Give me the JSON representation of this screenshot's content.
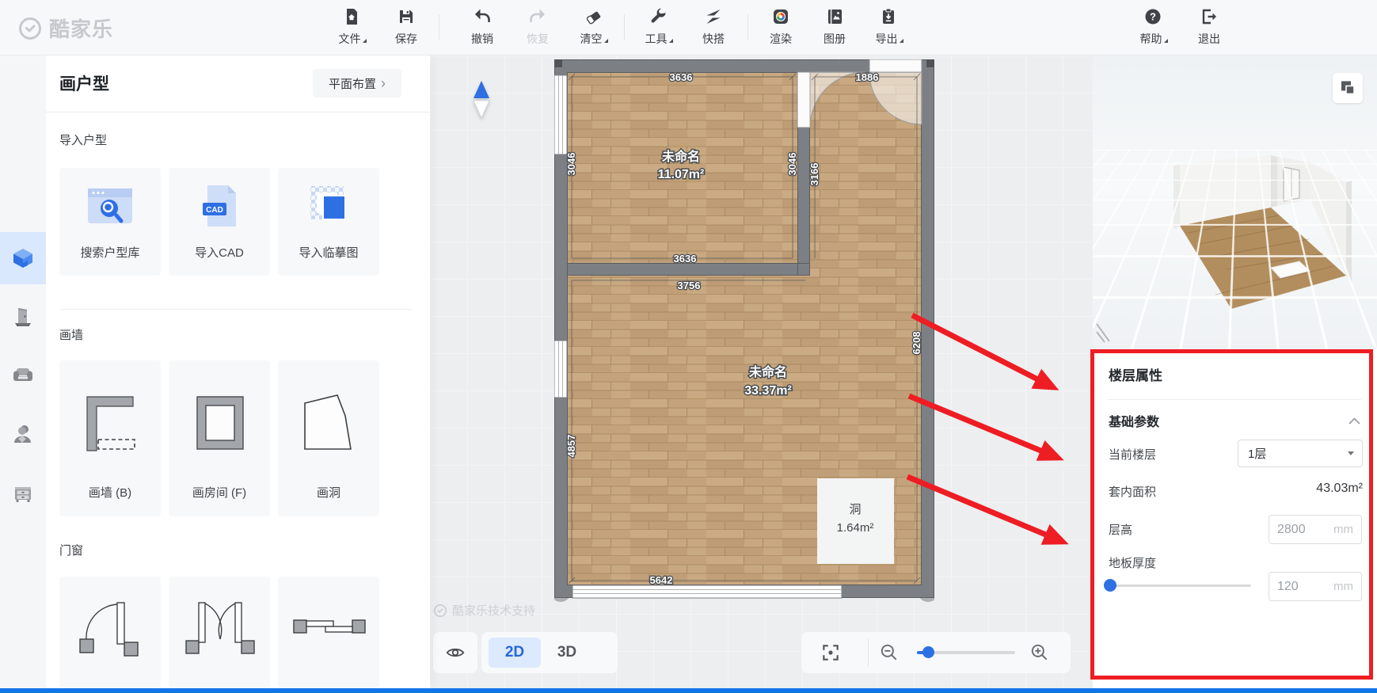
{
  "topbar": {
    "logo": "酷家乐",
    "items": [
      {
        "label": "文件"
      },
      {
        "label": "保存"
      },
      {
        "label": "撤销"
      },
      {
        "label": "恢复"
      },
      {
        "label": "清空"
      },
      {
        "label": "工具"
      },
      {
        "label": "快搭"
      },
      {
        "label": "渲染"
      },
      {
        "label": "图册"
      },
      {
        "label": "导出"
      },
      {
        "label": "帮助"
      },
      {
        "label": "退出"
      }
    ]
  },
  "left_panel": {
    "title": "画户型",
    "layout_switch": "平面布置",
    "section_import": {
      "title": "导入户型",
      "cards": [
        {
          "label": "搜索户型库"
        },
        {
          "label": "导入CAD",
          "badge": "CAD"
        },
        {
          "label": "导入临摹图"
        }
      ]
    },
    "section_wall": {
      "title": "画墙",
      "cards": [
        {
          "label": "画墙 (B)"
        },
        {
          "label": "画房间 (F)"
        },
        {
          "label": "画洞"
        }
      ]
    },
    "section_doors": {
      "title": "门窗"
    }
  },
  "canvas": {
    "watermark": "酷家乐技术支持",
    "rooms": [
      {
        "name": "未命名",
        "area": "11.07m²"
      },
      {
        "name": "未命名",
        "area": "33.37m²"
      }
    ],
    "hole": {
      "name": "洞",
      "area": "1.64m²"
    },
    "dims": {
      "top_left": "3636",
      "top_right": "1886",
      "left_upper": "3046",
      "left_lower": "4857",
      "inner_left": "3046",
      "inner_right": "3166",
      "mid_upper": "3636",
      "mid_lower": "3756",
      "right": "6208",
      "bottom": "5642"
    },
    "controls": {
      "view_2d": "2D",
      "view_3d": "3D"
    }
  },
  "right_panel": {
    "props": {
      "title": "楼层属性",
      "section": "基础参数",
      "floor_label": "当前楼层",
      "floor_value": "1层",
      "area_label": "套内面积",
      "area_value": "43.03m²",
      "height_label": "层高",
      "height_value": "2800",
      "height_unit": "mm",
      "thickness_label": "地板厚度",
      "thickness_value": "120",
      "thickness_unit": "mm"
    }
  }
}
